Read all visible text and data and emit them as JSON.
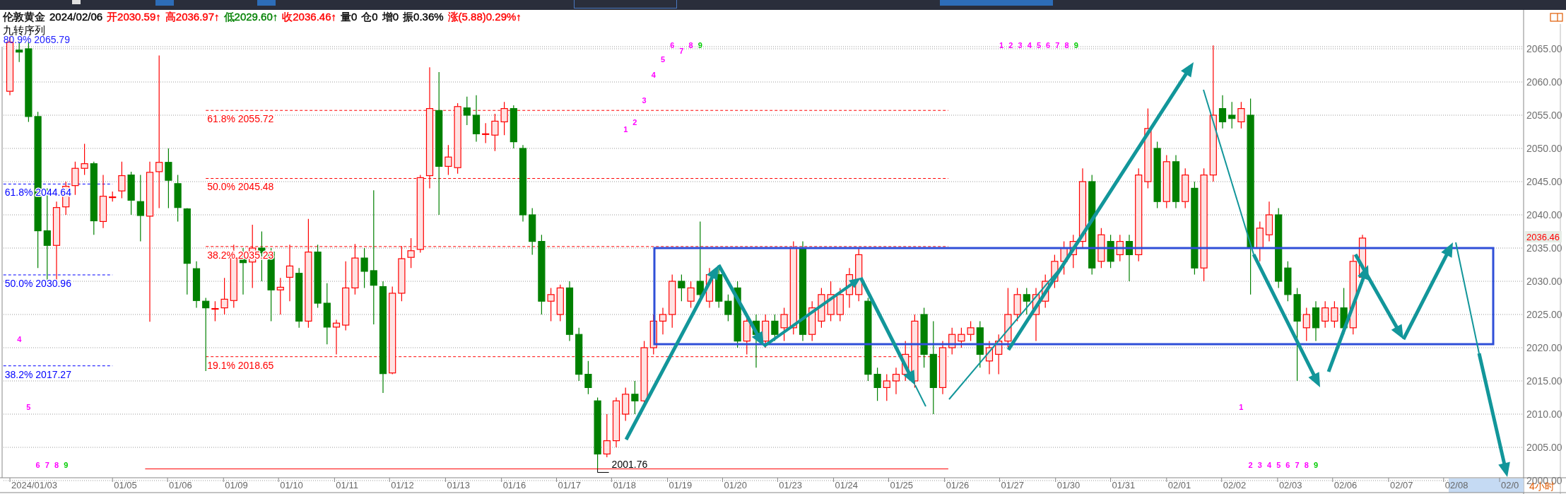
{
  "quote_bar": [
    {
      "text": "伦敦黄金",
      "color": "#000000"
    },
    {
      "text": "2024/02/06",
      "color": "#000000"
    },
    {
      "text": "开2030.59↑",
      "color": "#ff0000"
    },
    {
      "text": "高2036.97↑",
      "color": "#ff0000"
    },
    {
      "text": "低2029.60↑",
      "color": "#008000"
    },
    {
      "text": "收2036.46↑",
      "color": "#ff0000"
    },
    {
      "text": "量0",
      "color": "#000000"
    },
    {
      "text": "仓0",
      "color": "#000000"
    },
    {
      "text": "增0",
      "color": "#000000"
    },
    {
      "text": "振0.36%",
      "color": "#000000"
    },
    {
      "text": "涨(5.88)0.29%↑",
      "color": "#ff0000"
    }
  ],
  "indicator_name": "九转序列",
  "fib_top_label": "80.9% 2065.79",
  "fib_levels": [
    {
      "text": "61.8% 2044.64",
      "color": "#0000ff"
    },
    {
      "text": "50.0% 2030.96",
      "color": "#0000ff"
    },
    {
      "text": "38.2% 2017.27",
      "color": "#0000ff"
    },
    {
      "text": "61.8% 2055.72",
      "color": "#ff0000"
    },
    {
      "text": "50.0% 2045.48",
      "color": "#ff0000"
    },
    {
      "text": "38.2% 2035.23",
      "color": "#ff0000"
    },
    {
      "text": "19.1% 2018.65",
      "color": "#ff0000"
    }
  ],
  "low_label": "2001.76",
  "sequence_numbers": [
    {
      "text": "4",
      "color": "#ff00ff"
    },
    {
      "text": "5",
      "color": "#ff00ff"
    },
    {
      "text": "6",
      "color": "#ff00ff"
    },
    {
      "text": "7",
      "color": "#ff00ff"
    },
    {
      "text": "8",
      "color": "#ff00ff"
    },
    {
      "text": "9",
      "color": "#00cc00"
    },
    {
      "text": "1",
      "color": "#ff00ff"
    },
    {
      "text": "2",
      "color": "#ff00ff"
    },
    {
      "text": "3",
      "color": "#ff00ff"
    },
    {
      "text": "4",
      "color": "#ff00ff"
    },
    {
      "text": "5",
      "color": "#ff00ff"
    },
    {
      "text": "6",
      "color": "#ff00ff"
    },
    {
      "text": "7",
      "color": "#ff00ff"
    },
    {
      "text": "8",
      "color": "#ff00ff"
    },
    {
      "text": "9",
      "color": "#00cc00"
    },
    {
      "text": "1",
      "color": "#ff00ff"
    },
    {
      "text": "2",
      "color": "#ff00ff"
    },
    {
      "text": "3",
      "color": "#ff00ff"
    },
    {
      "text": "4",
      "color": "#ff00ff"
    },
    {
      "text": "5",
      "color": "#ff00ff"
    },
    {
      "text": "6",
      "color": "#ff00ff"
    },
    {
      "text": "7",
      "color": "#ff00ff"
    },
    {
      "text": "8",
      "color": "#ff00ff"
    },
    {
      "text": "9",
      "color": "#00cc00"
    },
    {
      "text": "1",
      "color": "#ff00ff"
    },
    {
      "text": "2",
      "color": "#ff00ff"
    },
    {
      "text": "3",
      "color": "#ff00ff"
    },
    {
      "text": "4",
      "color": "#ff00ff"
    },
    {
      "text": "5",
      "color": "#ff00ff"
    },
    {
      "text": "6",
      "color": "#ff00ff"
    },
    {
      "text": "7",
      "color": "#ff00ff"
    },
    {
      "text": "8",
      "color": "#ff00ff"
    },
    {
      "text": "9",
      "color": "#00cc00"
    }
  ],
  "price_axis_labels": [
    "2065.00",
    "2060.00",
    "2055.00",
    "2050.00",
    "2045.00",
    "2040.00",
    "2035.00",
    "2030.00",
    "2025.00",
    "2020.00",
    "2015.00",
    "2010.00",
    "2005.00",
    "2000.00"
  ],
  "date_axis_labels": [
    "2024/01/03",
    "01/05",
    "01/06",
    "01/09",
    "01/10",
    "01/11",
    "01/12",
    "01/13",
    "01/16",
    "01/17",
    "01/18",
    "01/19",
    "01/20",
    "01/23",
    "01/24",
    "01/25",
    "01/26",
    "01/27",
    "01/30",
    "01/31",
    "02/01",
    "02/02",
    "02/03",
    "02/06",
    "02/07",
    "02/08",
    "02/0"
  ],
  "price_tag": "2036.46",
  "period": "4小时"
}
